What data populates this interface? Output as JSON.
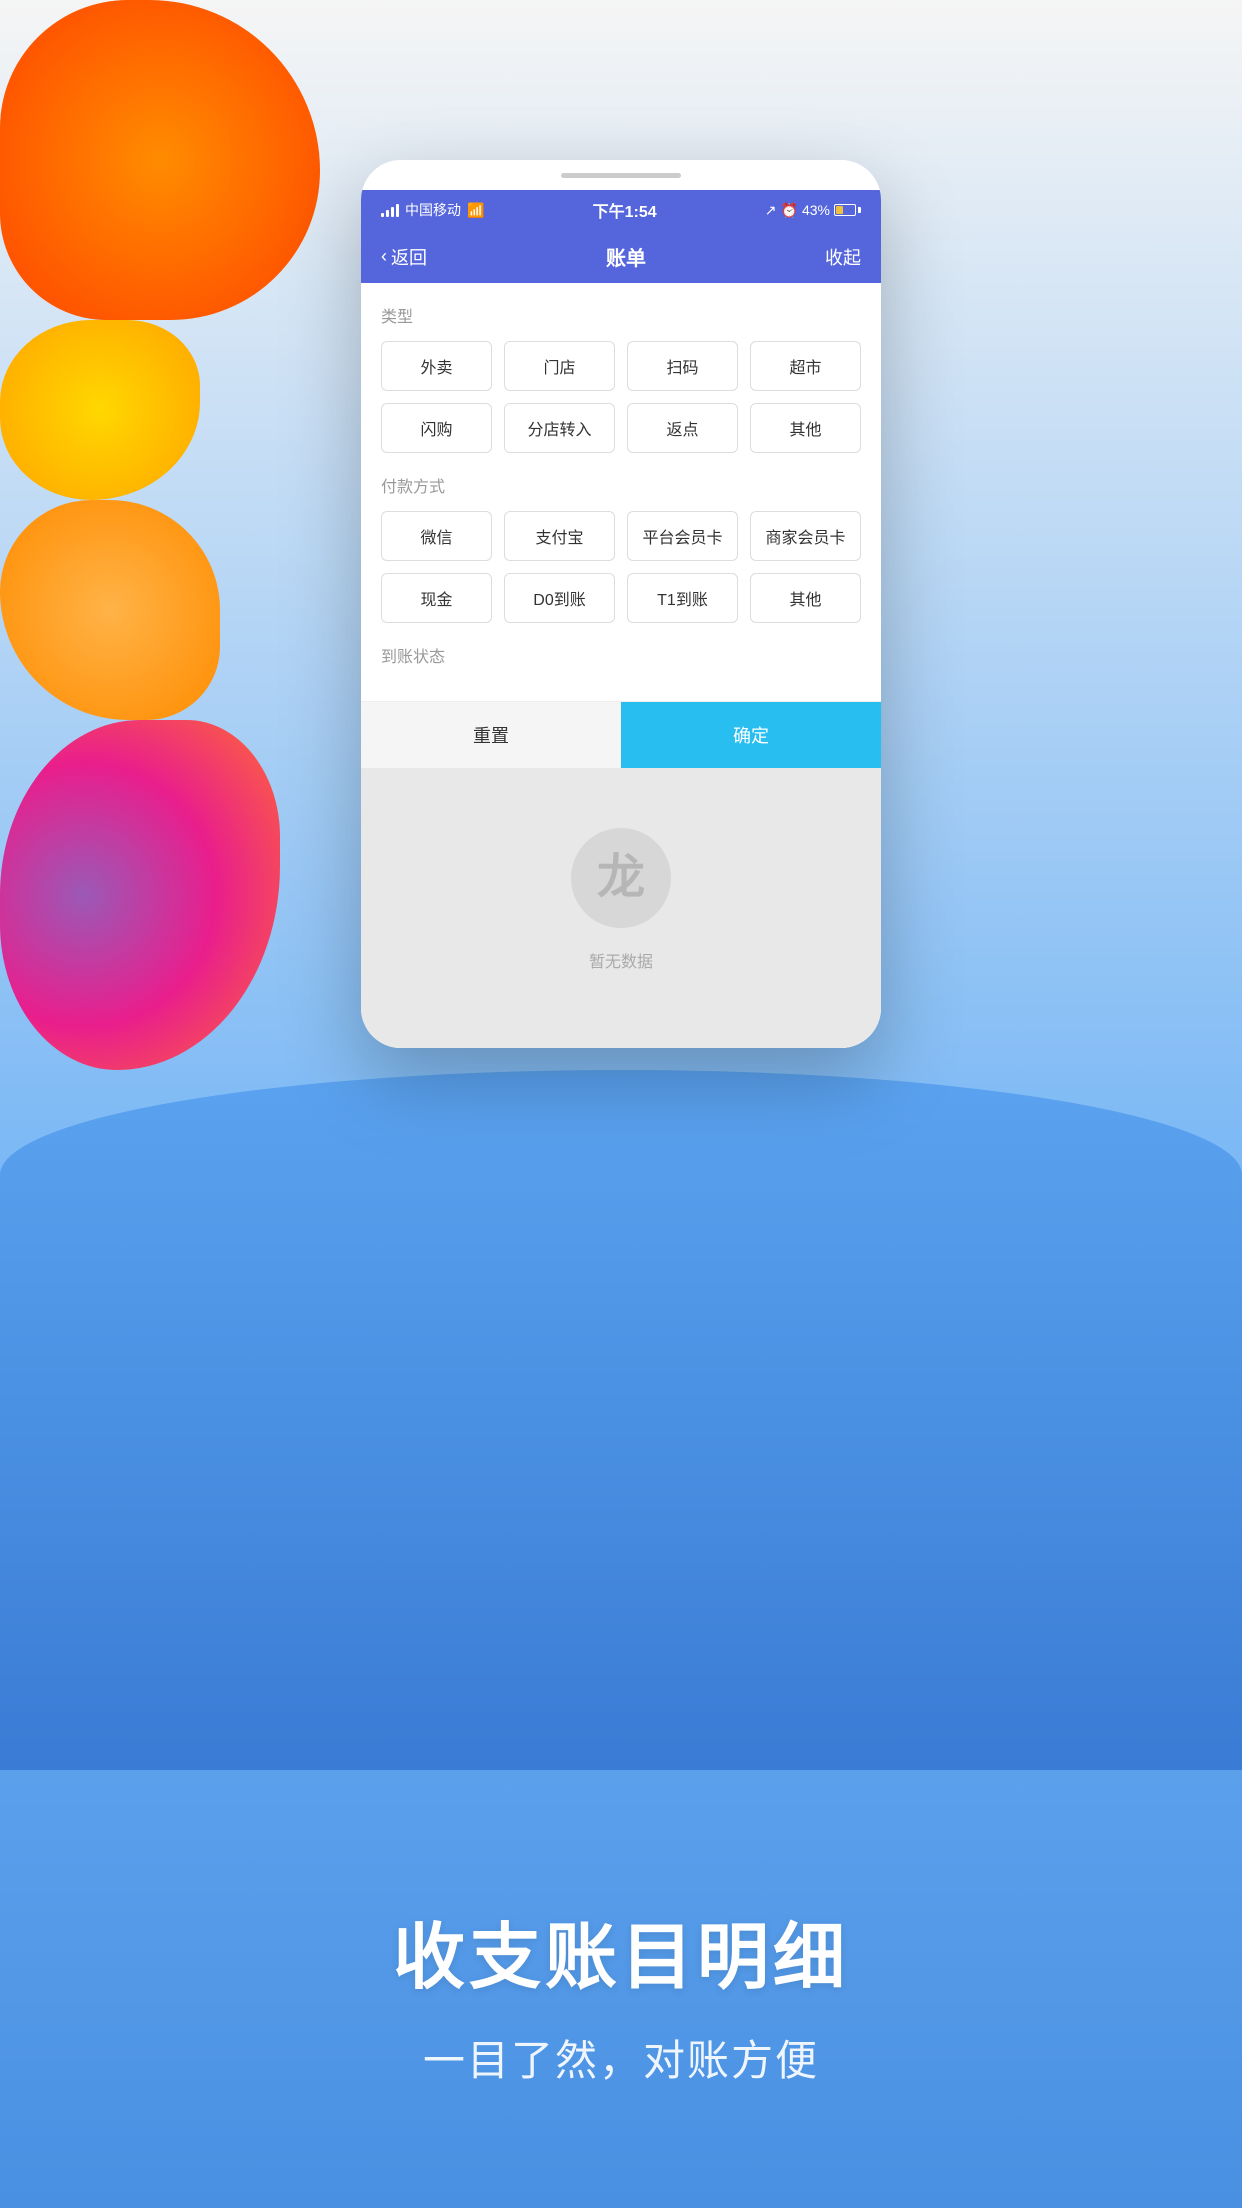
{
  "background": {
    "blobs": [
      "orange-top-left",
      "yellow-top",
      "orange-top-right",
      "purple-right",
      "blue-bottom"
    ]
  },
  "status_bar": {
    "carrier": "中国移动",
    "wifi": "WiFi",
    "time": "下午1:54",
    "battery": "43%"
  },
  "nav": {
    "back_label": "返回",
    "title": "账单",
    "right_label": "收起"
  },
  "filter": {
    "type_label": "类型",
    "type_buttons": [
      "外卖",
      "门店",
      "扫码",
      "超市",
      "闪购",
      "分店转入",
      "返点",
      "其他"
    ],
    "payment_label": "付款方式",
    "payment_buttons": [
      "微信",
      "支付宝",
      "平台会员卡",
      "商家会员卡",
      "现金",
      "D0到账",
      "T1到账",
      "其他"
    ],
    "status_label": "到账状态"
  },
  "actions": {
    "reset_label": "重置",
    "confirm_label": "确定"
  },
  "empty_state": {
    "text": "暂无数据"
  },
  "promo": {
    "title": "收支账目明细",
    "subtitle": "一目了然，对账方便"
  }
}
